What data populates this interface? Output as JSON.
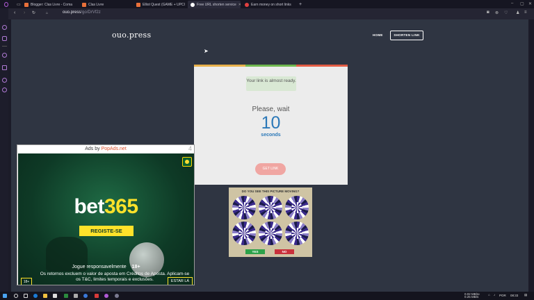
{
  "browser": {
    "tabs": [
      {
        "label": "Blogger: Clas Livre - Coma",
        "active": false
      },
      {
        "label": "Clas Livre",
        "active": false
      },
      {
        "label": "Elliot Quest (GAME + UPCI",
        "active": false
      },
      {
        "label": "Free URL shorten service",
        "active": true
      },
      {
        "label": "Earn money on short links",
        "active": false
      }
    ],
    "new_tab": "+",
    "url_host": "ouo.press",
    "url_path": "/go/DrVf2z"
  },
  "site": {
    "logo": "ouo.press",
    "nav_home": "HOME",
    "nav_shorten": "SHORTEN LINK"
  },
  "card": {
    "message": "Your link is almost ready.",
    "wait": "Please, wait",
    "countdown": "10",
    "unit": "seconds",
    "button": "GET LINK",
    "bar_colors": [
      "#e8b04a",
      "#6fb84f",
      "#e35c44"
    ]
  },
  "illusion_ad": {
    "title": "DO YOU SEE THIS PICTURE MOVING?",
    "yes": "YES",
    "no": "NO"
  },
  "popup_ad": {
    "prefix": "Ads by ",
    "brand": "PopAds.net",
    "close": "4",
    "logo_word": "bet",
    "logo_num": "365",
    "register": "REGISTE-SE",
    "line1": "Jogue responsavelmente",
    "age": "18+",
    "line2": "Os retornos excluem o valor de aposta em Créditos de Aposta. Aplicam-se os T&C, limites temporais e exclusões.",
    "age_badge": "18+",
    "cta": "ESTAR LÁ"
  },
  "taskbar": {
    "net_up": "0.02 MB/s",
    "net_down": "0.25 MB/s",
    "lang": "POR",
    "time": "08:33"
  }
}
